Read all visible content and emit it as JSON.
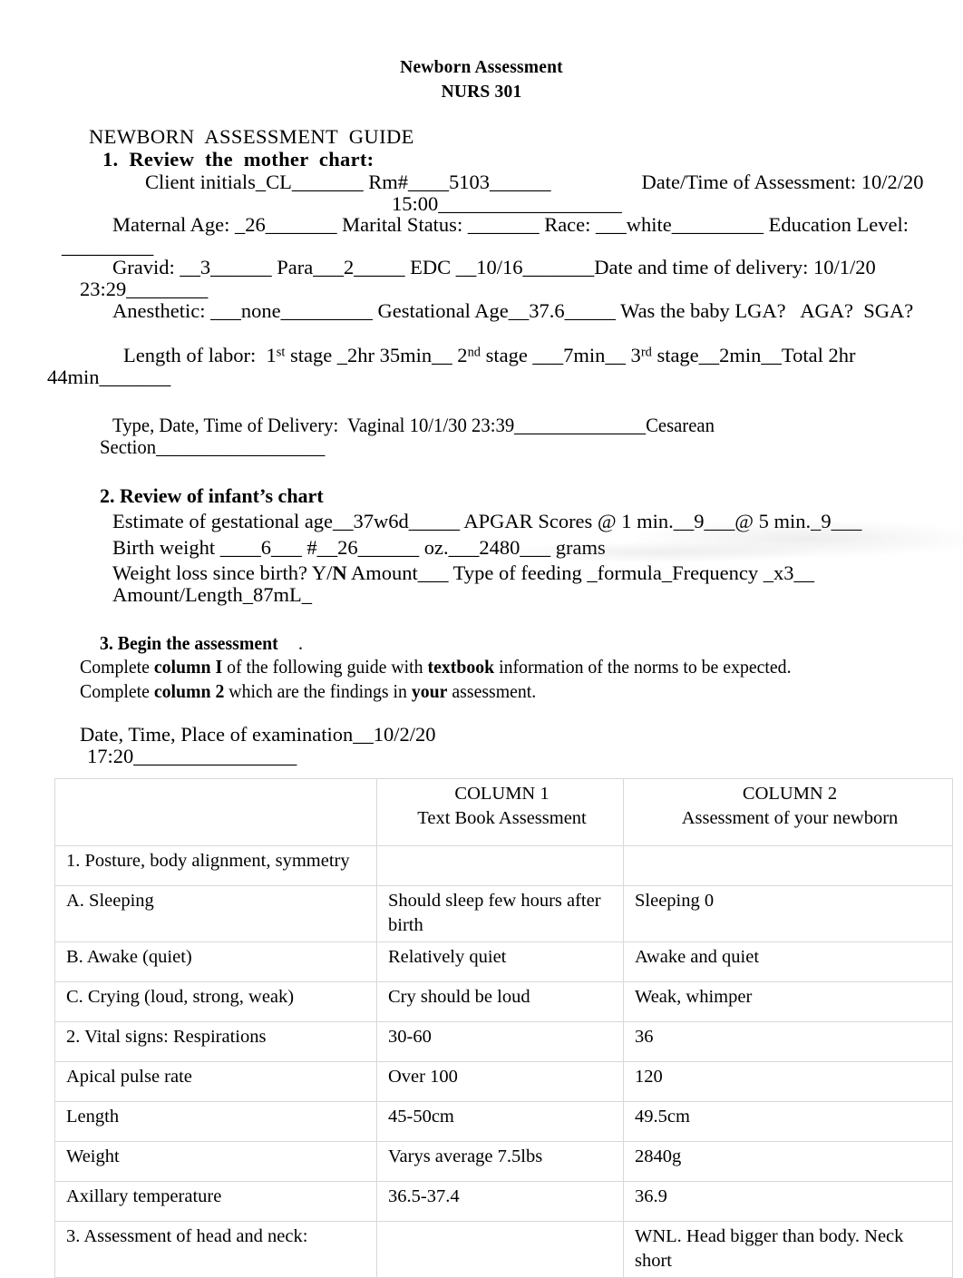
{
  "title": {
    "line1": "Newborn Assessment",
    "line2": "NURS 301"
  },
  "guide_heading": "NEWBORN  ASSESSMENT  GUIDE",
  "section1": {
    "heading_num": "1.",
    "heading_text": "Review  the  mother  chart",
    "heading_colon": ":",
    "line_client": "Client initials_CL_______ Rm#____5103______",
    "line_assessment_date": "Date/Time of Assessment: 10/2/20",
    "line_assessment_time": "15:00__________________",
    "line_maternal": "Maternal Age: _26_______ Marital Status: _______ Race: ___white_________ Education Level:",
    "line_maternal_cont": "_________",
    "line_gravid": "Gravid: __3______ Para___2_____ EDC __10/16_______",
    "line_delivery_dt": "Date and time of delivery: 10/1/20",
    "line_delivery_dt_cont": "23:29________",
    "line_anesthetic": "Anesthetic: ___none_________ Gestational Age__37.6_____ Was the baby LGA?   AGA?  SGA?",
    "labor_prefix": "Length of labor:  1",
    "labor_sup1": "st",
    "labor_mid1": " stage _2hr 35min__ 2",
    "labor_sup2": "nd",
    "labor_mid2": " stage ___7min__ 3",
    "labor_sup3": "rd",
    "labor_end": " stage__2min__Total 2hr",
    "labor_cont": "44min_______",
    "line_type_delivery": "Type, Date, Time of Delivery:  Vaginal 10/1/30 23:39______________Cesarean",
    "line_type_delivery_cont": "Section__________________"
  },
  "section2": {
    "heading": "2. Review of infant’s chart",
    "line_gest_age": "Estimate of gestational age__37w6d_____ APGAR Scores @ 1 min.__9___@ 5 min._9___",
    "line_birth_weight": "Birth weight ____6___ #__26______ oz.___2480___ grams",
    "line_weight_loss_a": "Weight loss since birth? Y/",
    "line_weight_loss_b": "N",
    "line_weight_loss_c": " Amount___ Type of feeding _formula_Frequency _x3__ Amount/Length_87mL_"
  },
  "section3": {
    "heading_bold": "3. Begin the assessment",
    "heading_tail": " .",
    "instr1_a": "Complete ",
    "instr1_b": "column I",
    "instr1_c": " of the following guide with ",
    "instr1_d": "textbook",
    "instr1_e": " information of the norms to be expected.",
    "instr2_a": "Complete ",
    "instr2_b": "column 2",
    "instr2_c": " which are the findings in ",
    "instr2_d": "your",
    "instr2_e": " assessment.",
    "exam_line": "Date, Time, Place of examination__10/2/20",
    "exam_line_cont": "17:20________________"
  },
  "table": {
    "headers": {
      "blank": "",
      "col1_title": "COLUMN 1",
      "col1_sub": "Text Book Assessment",
      "col2_title": "COLUMN 2",
      "col2_sub": "Assessment  of  your newborn"
    },
    "rows": [
      {
        "item": "1. Posture, body alignment, symmetry",
        "col1": "",
        "col2": "",
        "indent": "ind-f",
        "height": "reg"
      },
      {
        "item": "A. Sleeping",
        "col1": "Should sleep few hours after birth",
        "col2": "Sleeping 0",
        "indent": "ind-a",
        "height": "tall"
      },
      {
        "item": "B. Awake (quiet)",
        "col1": "Relatively quiet",
        "col2": "Awake and quiet",
        "indent": "ind-a",
        "height": "reg"
      },
      {
        "item": "C. Crying (loud, strong, weak)",
        "col1": "Cry should be loud",
        "col2": "Weak, whimper",
        "indent": "ind-a",
        "height": "reg"
      },
      {
        "item": "2. Vital signs:  Respirations",
        "col1": "30-60",
        "col2": "36",
        "indent": "ind-e",
        "height": "reg"
      },
      {
        "item": "Apical pulse rate",
        "col1": "Over 100",
        "col2": "120",
        "indent": "ind-b",
        "height": "reg"
      },
      {
        "item": "Length",
        "col1": "45-50cm",
        "col2": "49.5cm",
        "indent": "ind-c",
        "height": "reg"
      },
      {
        "item": "Weight",
        "col1": "Varys average 7.5lbs",
        "col2": "2840g",
        "indent": "ind-d",
        "height": "reg"
      },
      {
        "item": "Axillary temperature",
        "col1": "36.5-37.4",
        "col2": "36.9",
        "indent": "ind-b",
        "height": "reg"
      },
      {
        "item": "3. Assessment of head and neck:",
        "col1": "",
        "col2": "WNL. Head bigger than body. Neck short",
        "indent": "ind-f",
        "height": "reg"
      }
    ]
  }
}
